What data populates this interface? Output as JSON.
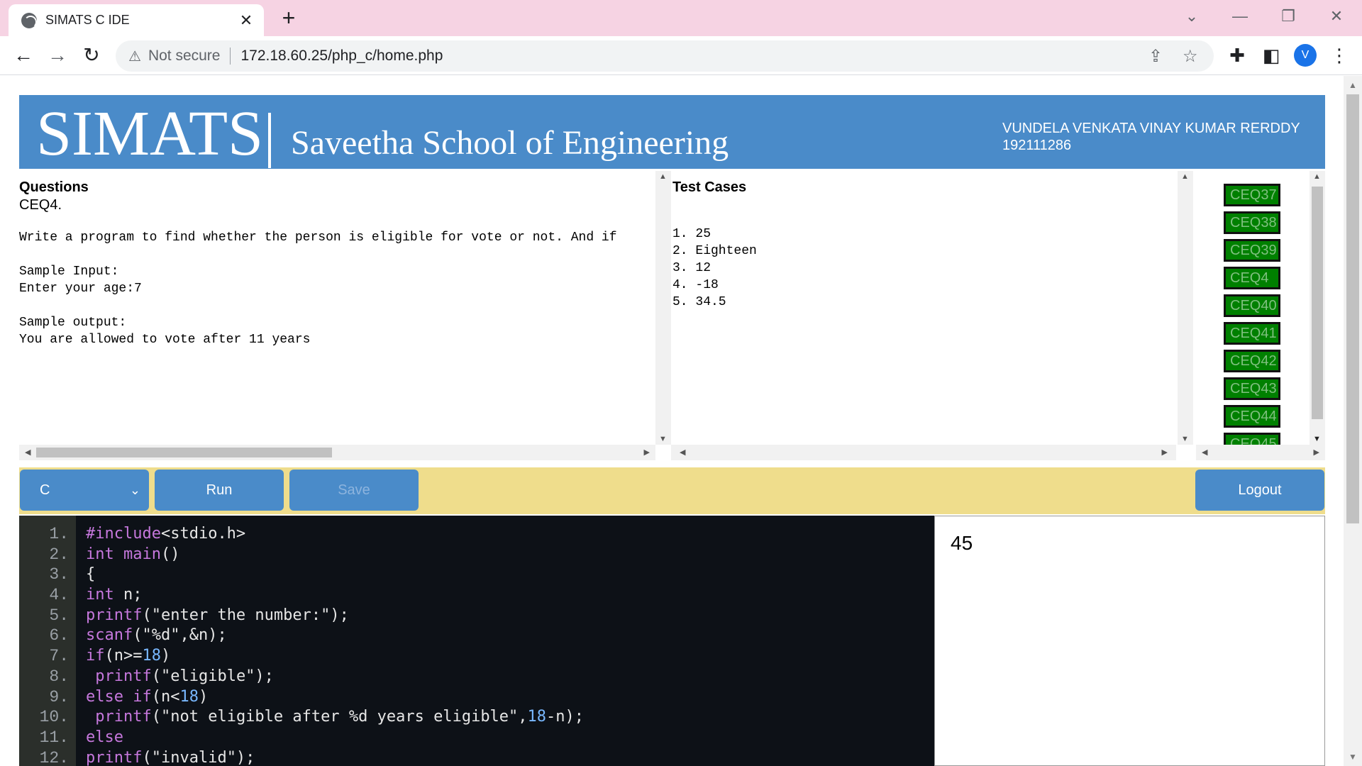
{
  "browser": {
    "tab_title": "SIMATS C IDE",
    "tab_close": "✕",
    "new_tab": "+",
    "not_secure": "Not secure",
    "url": "172.18.60.25/php_c/home.php",
    "profile_initial": "V"
  },
  "header": {
    "logo": "SIMATS",
    "school": "Saveetha School of Engineering",
    "user_name": "VUNDELA VENKATA VINAY KUMAR RERDDY",
    "user_id": "192111286"
  },
  "question": {
    "heading": "Questions",
    "code": "CEQ4.",
    "body": "Write a program to find whether the person is eligible for vote or not. And if\n\nSample Input:\nEnter your age:7\n\nSample output:\nYou are allowed to vote after 11 years"
  },
  "test_cases": {
    "heading": "Test Cases",
    "body": "1. 25\n2. Eighteen\n3. 12\n4. -18\n5. 34.5"
  },
  "question_list": [
    "CEQ37",
    "CEQ38",
    "CEQ39",
    "CEQ4",
    "CEQ40",
    "CEQ41",
    "CEQ42",
    "CEQ43",
    "CEQ44",
    "CEQ45"
  ],
  "controls": {
    "language": "C",
    "run": "Run",
    "save": "Save",
    "logout": "Logout"
  },
  "editor": {
    "line_numbers": [
      "1.",
      "2.",
      "3.",
      "4.",
      "5.",
      "6.",
      "7.",
      "8.",
      "9.",
      "10.",
      "11.",
      "12."
    ]
  },
  "output": {
    "value": "45"
  }
}
